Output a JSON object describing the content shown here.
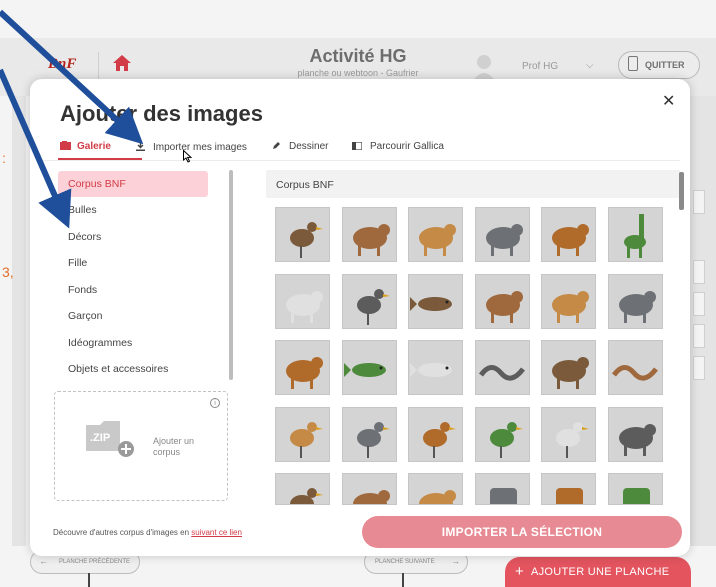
{
  "app": {
    "logo": "BnF",
    "title": "Activité HG",
    "subtitle": "planche ou webtoon - Gaufrier",
    "profile_name": "Prof HG",
    "quit_label": "QUITTER",
    "prev_label": "PLANCHE PRÉCÉDENTE",
    "next_label": "PLANCHE SUIVANTE",
    "add_planche_label": "AJOUTER UNE PLANCHE",
    "orange_text_1": ":",
    "orange_text_2": "3,"
  },
  "modal": {
    "title": "Ajouter des images",
    "tabs": [
      {
        "label": "Galerie",
        "icon": "gallery-icon",
        "active": true
      },
      {
        "label": "Importer mes images",
        "icon": "download-icon",
        "active": false
      },
      {
        "label": "Dessiner",
        "icon": "pencil-icon",
        "active": false
      },
      {
        "label": "Parcourir Gallica",
        "icon": "book-icon",
        "active": false
      }
    ],
    "sidebar": [
      {
        "label": "Corpus BNF",
        "active": true
      },
      {
        "label": "Bulles"
      },
      {
        "label": "Décors"
      },
      {
        "label": "Fille"
      },
      {
        "label": "Fonds"
      },
      {
        "label": "Garçon"
      },
      {
        "label": "Idéogrammes"
      },
      {
        "label": "Objets et accessoires"
      }
    ],
    "upload": {
      "zip_text": ".ZIP",
      "label_line1": "Ajouter un",
      "label_line2": "corpus"
    },
    "footnote_text": "Découvre d'autres corpus d'images en ",
    "footnote_link": "suivant ce lien",
    "gallery_title": "Corpus BNF",
    "import_button": "IMPORTER LA SÉLECTION",
    "thumbnails": [
      [
        "eagle",
        "deer",
        "camel",
        "camel",
        "elephant",
        "giraffe"
      ],
      [
        "lion",
        "pelican",
        "fish",
        "rhinoceros",
        "monkey",
        "tiger"
      ],
      [
        "cow",
        "whale",
        "fish",
        "snake",
        "frog",
        "lizard"
      ],
      [
        "swan",
        "ostrich",
        "rooster",
        "owl",
        "vulture",
        "mouse"
      ],
      [
        "bird",
        "monkey",
        "armadillo",
        "drum",
        "hammer",
        "watering-can"
      ]
    ]
  },
  "colors": {
    "accent": "#d23c46",
    "arrow": "#1f4e9a",
    "button": "#e88a93"
  }
}
